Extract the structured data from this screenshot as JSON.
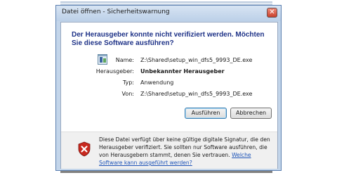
{
  "window": {
    "title": "Datei öffnen - Sicherheitswarnung",
    "close_glyph": "✕"
  },
  "headline": "Der Herausgeber konnte nicht verifiziert werden. Möchten Sie diese Software ausführen?",
  "details": {
    "name_label": "Name:",
    "name_value": "Z:\\Shared\\setup_win_dfs5_9993_DE.exe",
    "publisher_label": "Herausgeber:",
    "publisher_value": "Unbekannter Herausgeber",
    "type_label": "Typ:",
    "type_value": "Anwendung",
    "from_label": "Von:",
    "from_value": "Z:\\Shared\\setup_win_dfs5_9993_DE.exe"
  },
  "buttons": {
    "run": "Ausführen",
    "cancel": "Abbrechen"
  },
  "footer": {
    "warning_text": "Diese Datei verfügt über keine gültige digitale Signatur, die den Herausgeber verifiziert. Sie sollten nur Software ausführen, die von Herausgebern stammt, denen Sie vertrauen.",
    "help_link": "Welche Software kann ausgeführt werden?"
  },
  "colors": {
    "headline": "#1e3287",
    "link": "#1e54b8",
    "shield_red": "#c8281e"
  }
}
